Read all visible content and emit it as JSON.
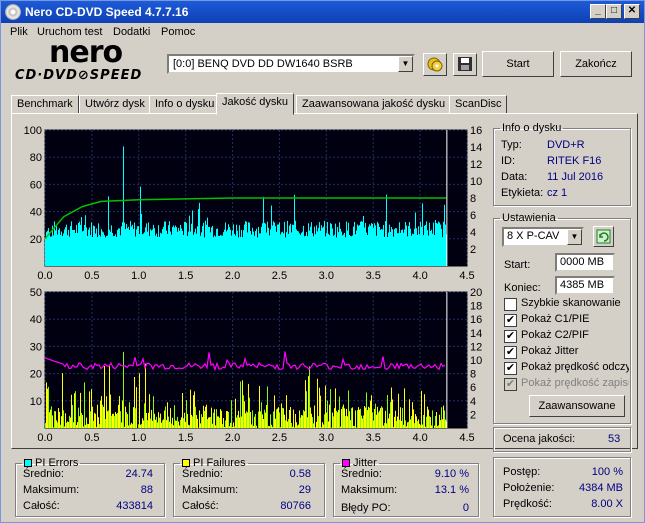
{
  "window": {
    "title": "Nero CD-DVD Speed 4.7.7.16",
    "minimize": "_",
    "maximize": "□",
    "close": "✕"
  },
  "menu": [
    "Plik",
    "Uruchom test",
    "Dodatki",
    "Pomoc"
  ],
  "logo": {
    "line1": "nero",
    "line2": "CD·DVD⊘SPEED"
  },
  "drive": {
    "selected": "[0:0]  BENQ DVD DD DW1640 BSRB"
  },
  "buttons": {
    "start": "Start",
    "exit": "Zakończ",
    "advanced": "Zaawansowane"
  },
  "tabs": [
    "Benchmark",
    "Utwórz dysk",
    "Info o dysku",
    "Jakość dysku",
    "Zaawansowana jakość dysku",
    "ScanDisc"
  ],
  "active_tab": 3,
  "disc_info": {
    "title": "Info o dysku",
    "rows": [
      {
        "label": "Typ:",
        "value": "DVD+R"
      },
      {
        "label": "ID:",
        "value": "RITEK F16"
      },
      {
        "label": "Data:",
        "value": "11 Jul 2016"
      },
      {
        "label": "Etykieta:",
        "value": "cz 1"
      }
    ]
  },
  "settings": {
    "title": "Ustawienia",
    "speed": "8 X P-CAV",
    "start_label": "Start:",
    "start_value": "0000 MB",
    "end_label": "Koniec:",
    "end_value": "4385 MB",
    "checks": [
      {
        "label": "Szybkie skanowanie",
        "checked": false,
        "enabled": true
      },
      {
        "label": "Pokaż C1/PIE",
        "checked": true,
        "enabled": true
      },
      {
        "label": "Pokaż C2/PIF",
        "checked": true,
        "enabled": true
      },
      {
        "label": "Pokaż Jitter",
        "checked": true,
        "enabled": true
      },
      {
        "label": "Pokaż prędkość odczytu",
        "checked": true,
        "enabled": true
      },
      {
        "label": "Pokaż prędkość zapisu",
        "checked": true,
        "enabled": false
      }
    ]
  },
  "quality": {
    "label": "Ocena jakości:",
    "value": "53"
  },
  "pi_errors": {
    "title": "PI Errors",
    "color": "#00ffff",
    "rows": [
      {
        "label": "Średnio:",
        "value": "24.74"
      },
      {
        "label": "Maksimum:",
        "value": "88"
      },
      {
        "label": "Całość:",
        "value": "433814"
      }
    ]
  },
  "pi_failures": {
    "title": "PI Failures",
    "color": "#ffff00",
    "rows": [
      {
        "label": "Średnio:",
        "value": "0.58"
      },
      {
        "label": "Maksimum:",
        "value": "29"
      },
      {
        "label": "Całość:",
        "value": "80766"
      }
    ]
  },
  "jitter": {
    "title": "Jitter",
    "color": "#ff00ff",
    "rows": [
      {
        "label": "Średnio:",
        "value": "9.10 %"
      },
      {
        "label": "Maksimum:",
        "value": "13.1 %"
      }
    ],
    "po_label": "Błędy PO:",
    "po_value": "0"
  },
  "progress": {
    "rows": [
      {
        "label": "Postęp:",
        "value": "100 %"
      },
      {
        "label": "Położenie:",
        "value": "4384 MB"
      },
      {
        "label": "Prędkość:",
        "value": "8.00 X"
      }
    ]
  },
  "chart_data": [
    {
      "type": "bar",
      "title": "PI Errors",
      "x_range": [
        0,
        4.5
      ],
      "x_ticks": [
        "0.0",
        "0.5",
        "1.0",
        "1.5",
        "2.0",
        "2.5",
        "3.0",
        "3.5",
        "4.0",
        "4.5"
      ],
      "ylim_left": [
        0,
        100
      ],
      "y_ticks_left": [
        "100",
        "80",
        "60",
        "40",
        "20"
      ],
      "ylim_right": [
        0,
        16
      ],
      "y_ticks_right": [
        "16",
        "14",
        "12",
        "10",
        "8",
        "6",
        "4",
        "2"
      ],
      "series": [
        {
          "name": "PI Errors",
          "color": "#00ffff",
          "average": 24.74,
          "max": 88
        },
        {
          "name": "Read speed",
          "color": "#00c000",
          "points": [
            [
              0.0,
              3.2
            ],
            [
              0.2,
              5.8
            ],
            [
              0.4,
              7.0
            ],
            [
              0.6,
              7.6
            ],
            [
              1.0,
              7.8
            ],
            [
              1.5,
              7.9
            ],
            [
              2.0,
              8.0
            ],
            [
              4.28,
              8.0
            ]
          ]
        }
      ]
    },
    {
      "type": "bar",
      "title": "PI Failures",
      "x_range": [
        0,
        4.5
      ],
      "x_ticks": [
        "0.0",
        "0.5",
        "1.0",
        "1.5",
        "2.0",
        "2.5",
        "3.0",
        "3.5",
        "4.0",
        "4.5"
      ],
      "ylim_left": [
        0,
        50
      ],
      "y_ticks_left": [
        "50",
        "40",
        "30",
        "20",
        "10"
      ],
      "ylim_right": [
        0,
        20
      ],
      "y_ticks_right": [
        "20",
        "18",
        "16",
        "14",
        "12",
        "10",
        "8",
        "6",
        "4",
        "2"
      ],
      "series": [
        {
          "name": "PI Failures",
          "color": "#ffff00",
          "average": 0.58,
          "max": 29
        },
        {
          "name": "Jitter",
          "color": "#ff00ff",
          "average": 9.1,
          "max": 13.1
        }
      ]
    }
  ]
}
